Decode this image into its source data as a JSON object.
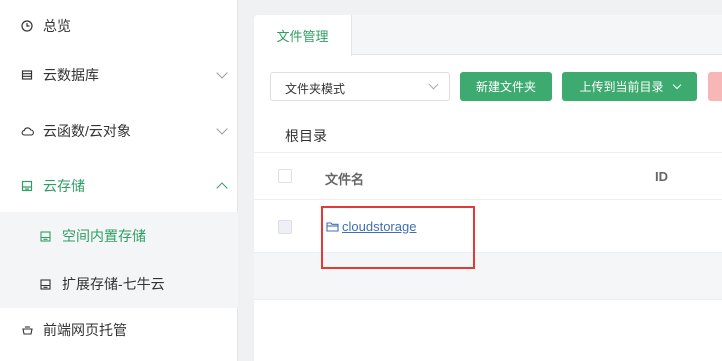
{
  "sidebar": {
    "items": [
      {
        "label": "总览",
        "icon": "clock-icon"
      },
      {
        "label": "云数据库",
        "icon": "database-icon"
      },
      {
        "label": "云函数/云对象",
        "icon": "cloud-icon"
      },
      {
        "label": "云存储",
        "icon": "storage-icon"
      },
      {
        "label": "前端网页托管",
        "icon": "hosting-icon"
      }
    ],
    "sub_items": [
      {
        "label": "空间内置存储",
        "icon": "storage-box-icon"
      },
      {
        "label": "扩展存储-七牛云",
        "icon": "storage-box-icon"
      }
    ]
  },
  "tabs": [
    {
      "label": "文件管理"
    }
  ],
  "toolbar": {
    "mode_select": "文件夹模式",
    "new_folder": "新建文件夹",
    "upload": "上传到当前目录"
  },
  "breadcrumb": "根目录",
  "table": {
    "columns": [
      "文件名",
      "ID"
    ],
    "rows": [
      {
        "name": "cloudstorage",
        "icon": "folder-icon"
      }
    ]
  },
  "colors": {
    "accent": "#3dab6f",
    "link": "#3f6fb5",
    "highlight": "#e53935"
  }
}
